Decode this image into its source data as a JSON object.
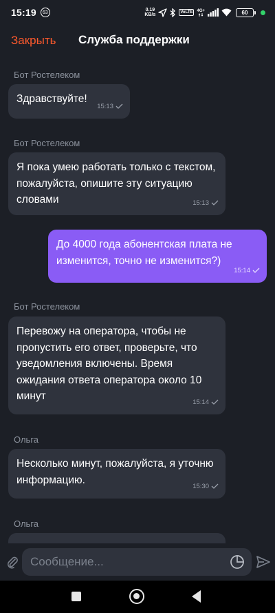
{
  "status_bar": {
    "time": "15:19",
    "notification_count": "63",
    "speed_value": "0.19",
    "speed_unit": "KB/s",
    "sim_tag": "VoLTE",
    "network": "4G+",
    "battery": "60"
  },
  "header": {
    "close_label": "Закрыть",
    "title": "Служба поддержки"
  },
  "messages": [
    {
      "sender": "Бот Ростелеком",
      "text": "Здравствуйте!",
      "time": "15:13",
      "direction": "in"
    },
    {
      "sender": "Бот Ростелеком",
      "text": "Я пока умею работать только с текстом, пожалуйста, опишите эту ситуацию словами",
      "time": "15:13",
      "direction": "in"
    },
    {
      "sender": "",
      "text": "До 4000 года абонентская плата не изменится, точно не изменится?)",
      "time": "15:14",
      "direction": "out"
    },
    {
      "sender": "Бот Ростелеком",
      "text": "Перевожу на оператора, чтобы не пропустить его ответ, проверьте, что уведомления включены. Время ожидания ответа оператора около 10 минут",
      "time": "15:14",
      "direction": "in"
    },
    {
      "sender": "Ольга",
      "text": "Несколько минут, пожалуйста, я уточню информацию.",
      "time": "15:30",
      "direction": "in"
    },
    {
      "sender": "Ольга",
      "text": "",
      "time": "",
      "direction": "in"
    }
  ],
  "composer": {
    "placeholder": "Сообщение..."
  },
  "colors": {
    "accent": "#ff5a2d",
    "outgoing_bubble": "#8a5cf5",
    "incoming_bubble": "#2f333d",
    "background": "#1c1f26"
  }
}
